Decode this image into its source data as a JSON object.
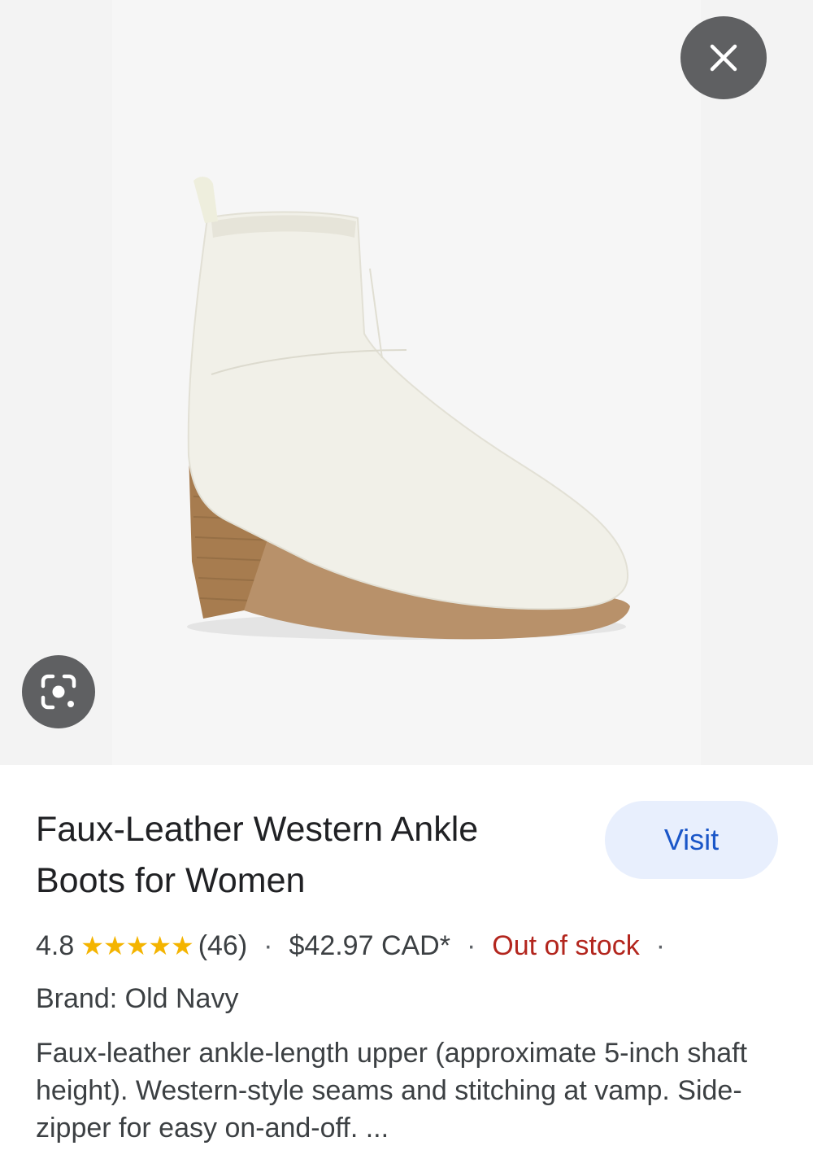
{
  "product": {
    "title": "Faux-Leather Western Ankle Boots for Women",
    "rating": "4.8",
    "stars": "★★★★★",
    "review_count": "(46)",
    "price": "$42.97 CAD*",
    "stock_status": "Out of stock",
    "separator": "·",
    "brand": "Brand: Old Navy",
    "description": "Faux-leather ankle-length upper (approximate 5-inch shaft height). Western-style seams and stitching at vamp. Side-zipper for easy on-and-off. ..."
  },
  "actions": {
    "visit_label": "Visit"
  },
  "icons": {
    "close": "close-icon",
    "lens": "google-lens-icon"
  },
  "colors": {
    "stars": "#f4b400",
    "out_of_stock": "#b3261e",
    "visit_button_bg": "#e8effd",
    "visit_button_text": "#1a56c8",
    "overlay_button_bg": "#5f6062"
  }
}
